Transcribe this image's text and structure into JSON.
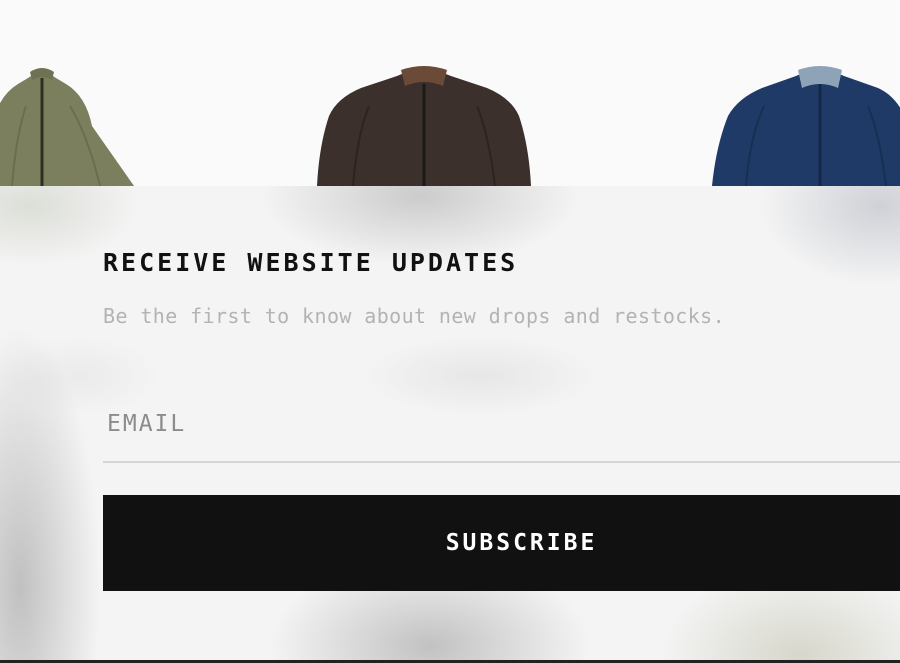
{
  "products": [
    {
      "name": "olive-bomber-jacket",
      "color": "#7b7f5d",
      "collar": "#6e7253"
    },
    {
      "name": "brown-bomber-jacket",
      "color": "#3b302b",
      "collar": "#6b4a38"
    },
    {
      "name": "navy-bomber-jacket",
      "color": "#1f3a66",
      "collar": "#8fa3b8"
    }
  ],
  "newsletter": {
    "title": "RECEIVE WEBSITE UPDATES",
    "subtitle": "Be the first to know about new drops and restocks.",
    "email_placeholder": "EMAIL",
    "email_value": "",
    "subscribe_label": "SUBSCRIBE"
  },
  "colors": {
    "button_bg": "#111111",
    "button_text": "#ffffff",
    "title_text": "#111111",
    "subtitle_text": "#b3b3b3"
  }
}
